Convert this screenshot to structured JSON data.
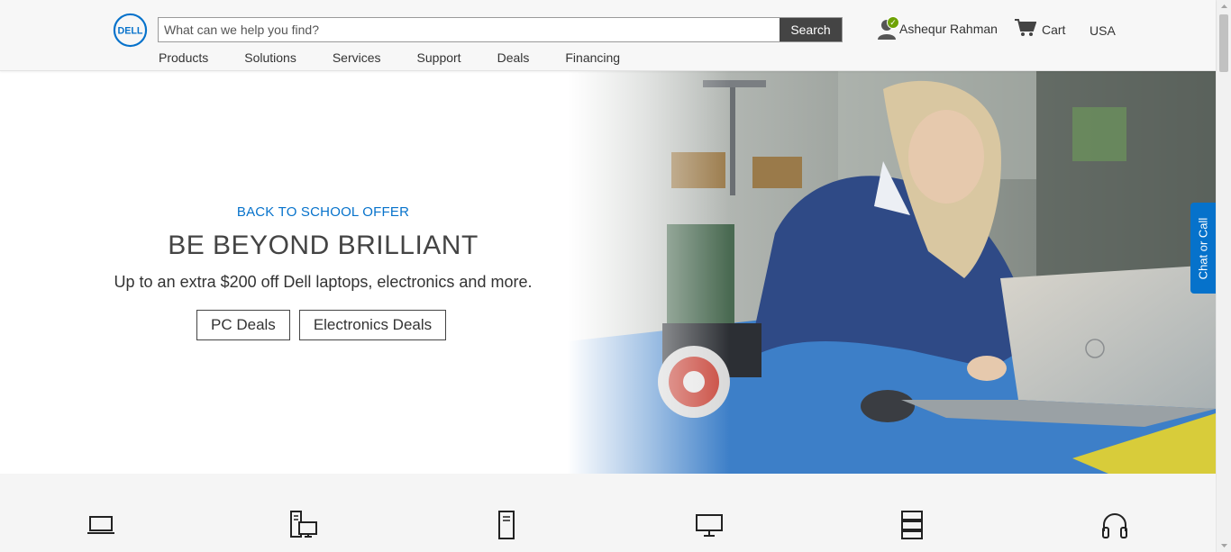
{
  "header": {
    "logo_text": "DELL",
    "search": {
      "placeholder": "What can we help you find?",
      "button_label": "Search"
    },
    "user": {
      "name": "Ashequr Rahman"
    },
    "cart_label": "Cart",
    "country": "USA"
  },
  "nav": {
    "items": [
      {
        "label": "Products"
      },
      {
        "label": "Solutions"
      },
      {
        "label": "Services"
      },
      {
        "label": "Support"
      },
      {
        "label": "Deals"
      },
      {
        "label": "Financing"
      }
    ]
  },
  "hero": {
    "eyebrow": "BACK TO SCHOOL OFFER",
    "headline": "BE BEYOND BRILLIANT",
    "subhead": "Up to an extra $200 off Dell laptops, electronics and more.",
    "buttons": [
      {
        "label": "PC Deals"
      },
      {
        "label": "Electronics Deals"
      }
    ]
  },
  "chat_tab": {
    "label": "Chat or Call"
  },
  "categories": [
    {
      "icon": "laptop-icon"
    },
    {
      "icon": "desktop-tower-icon"
    },
    {
      "icon": "tower-icon"
    },
    {
      "icon": "monitor-icon"
    },
    {
      "icon": "server-icon"
    },
    {
      "icon": "headphones-icon"
    }
  ],
  "colors": {
    "brand_blue": "#0672cb",
    "status_green": "#6ea204",
    "search_button": "#444444"
  }
}
